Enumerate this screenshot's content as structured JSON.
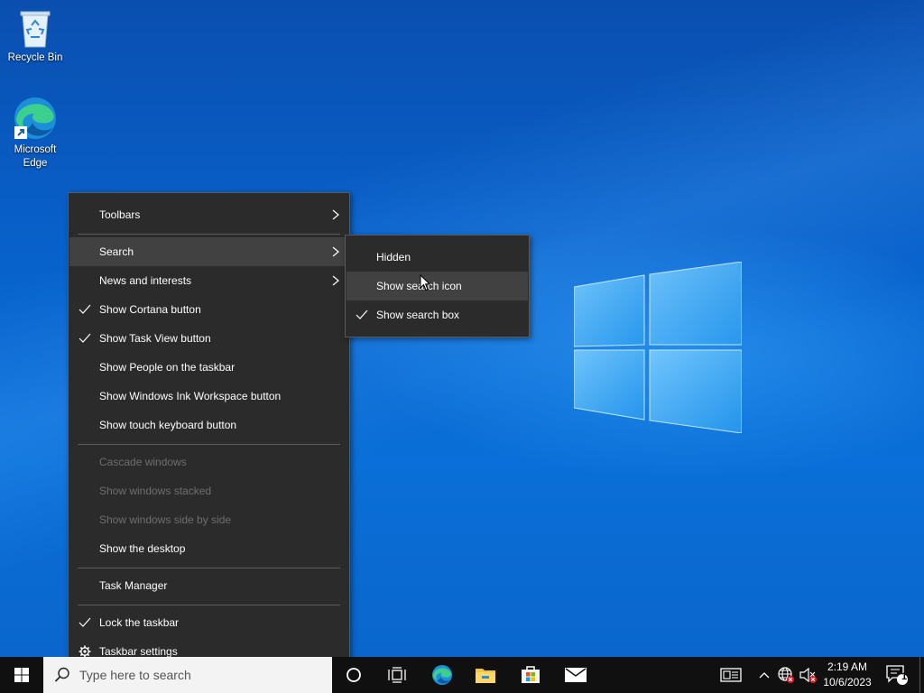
{
  "desktop": {
    "icons": [
      {
        "label": "Recycle Bin",
        "icon": "recycle-bin-icon"
      },
      {
        "label": "Microsoft Edge",
        "icon": "edge-icon"
      }
    ]
  },
  "context_menu": {
    "items": [
      {
        "label": "Toolbars",
        "submenu": true
      },
      {
        "label": "Search",
        "submenu": true,
        "highlighted": true
      },
      {
        "label": "News and interests",
        "submenu": true
      },
      {
        "label": "Show Cortana button",
        "checked": true
      },
      {
        "label": "Show Task View button",
        "checked": true
      },
      {
        "label": "Show People on the taskbar"
      },
      {
        "label": "Show Windows Ink Workspace button"
      },
      {
        "label": "Show touch keyboard button"
      },
      {
        "label": "Cascade windows",
        "disabled": true
      },
      {
        "label": "Show windows stacked",
        "disabled": true
      },
      {
        "label": "Show windows side by side",
        "disabled": true
      },
      {
        "label": "Show the desktop"
      },
      {
        "label": "Task Manager"
      },
      {
        "label": "Lock the taskbar",
        "checked": true
      },
      {
        "label": "Taskbar settings",
        "icon": "gear-icon"
      }
    ]
  },
  "search_submenu": {
    "items": [
      {
        "label": "Hidden"
      },
      {
        "label": "Show search icon",
        "hovered": true
      },
      {
        "label": "Show search box",
        "checked": true
      }
    ]
  },
  "taskbar": {
    "search_placeholder": "Type here to search",
    "pinned": [
      "start-icon",
      "cortana-icon",
      "task-view-icon",
      "edge-icon",
      "file-explorer-icon",
      "store-icon",
      "mail-icon"
    ],
    "clock": {
      "time": "2:19 AM",
      "date": "10/6/2023"
    },
    "notification_count": "1"
  },
  "colors": {
    "menu_bg": "#2b2b2b",
    "menu_hover": "#414141",
    "taskbar_bg": "#101010",
    "accent": "#76b9ed"
  }
}
